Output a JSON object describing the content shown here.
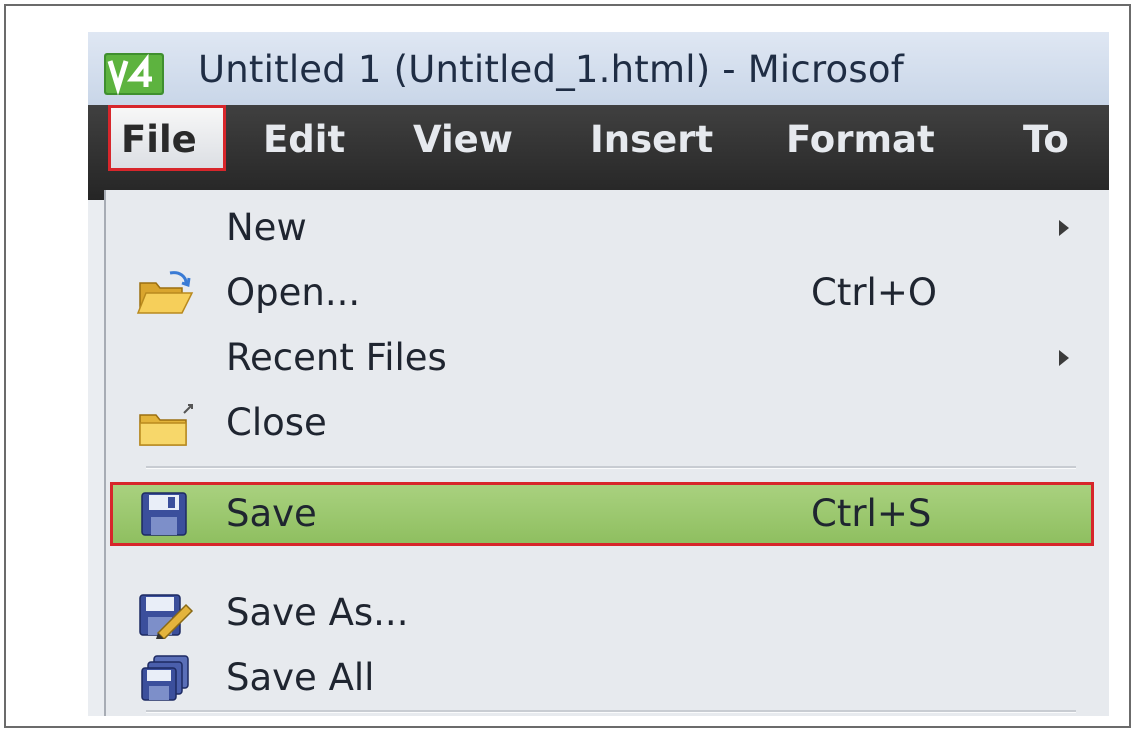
{
  "window": {
    "title": "Untitled 1 (Untitled_1.html) - Microsof"
  },
  "menubar": {
    "items": [
      {
        "label": "File"
      },
      {
        "label": "Edit"
      },
      {
        "label": "View"
      },
      {
        "label": "Insert"
      },
      {
        "label": "Format"
      },
      {
        "label": "To"
      }
    ]
  },
  "file_menu": {
    "items": [
      {
        "label": "New",
        "shortcut": "",
        "icon": "none",
        "submenu": true
      },
      {
        "label": "Open...",
        "shortcut": "Ctrl+O",
        "icon": "open-folder-icon",
        "submenu": false
      },
      {
        "label": "Recent Files",
        "shortcut": "",
        "icon": "none",
        "submenu": true
      },
      {
        "label": "Close",
        "shortcut": "",
        "icon": "close-folder-icon",
        "submenu": false
      },
      {
        "label": "Save",
        "shortcut": "Ctrl+S",
        "icon": "save-floppy-icon",
        "submenu": false,
        "highlighted": true
      },
      {
        "label": "Save As...",
        "shortcut": "",
        "icon": "save-as-icon",
        "submenu": false
      },
      {
        "label": "Save All",
        "shortcut": "",
        "icon": "save-all-icon",
        "submenu": false
      }
    ]
  },
  "colors": {
    "highlight_fill": "#9cc86c",
    "highlight_border": "#d7262b",
    "menubar_bg": "#2f2f2f"
  }
}
